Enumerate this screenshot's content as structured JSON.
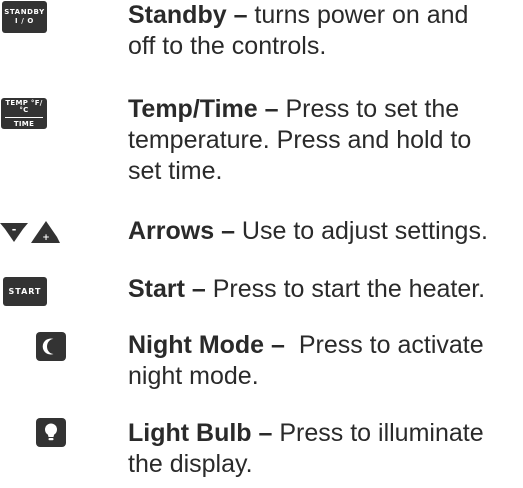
{
  "items": [
    {
      "title": "Standby –",
      "text_lines": [
        " turns power on and",
        "off to the controls."
      ],
      "icon": "standby-key-icon",
      "key_lines": [
        "STANDBY",
        "I / O"
      ]
    },
    {
      "title": "Temp/Time –",
      "text_lines": [
        " Press to set the",
        "temperature. Press and hold to",
        "set time."
      ],
      "icon": "temp-time-key-icon",
      "key_lines": [
        "TEMP °F/°C",
        "TIME"
      ]
    },
    {
      "title": "Arrows –",
      "text_lines": [
        " Use to adjust settings."
      ],
      "icon": "arrows-keys-icon",
      "key_lines": [
        "-",
        "+"
      ]
    },
    {
      "title": "Start –",
      "text_lines": [
        " Press to start the heater."
      ],
      "icon": "start-key-icon",
      "key_lines": [
        "START"
      ]
    },
    {
      "title": "Night Mode –",
      "text_lines": [
        "  Press to activate",
        "night mode."
      ],
      "icon": "night-mode-moon-icon",
      "key_lines": []
    },
    {
      "title": "Light Bulb –",
      "text_lines": [
        " Press to illuminate",
        "the display."
      ],
      "icon": "light-bulb-icon",
      "key_lines": []
    }
  ],
  "colors": {
    "key_background": "#333333",
    "key_text": "#ffffff",
    "body_text": "#2a2a2a"
  }
}
